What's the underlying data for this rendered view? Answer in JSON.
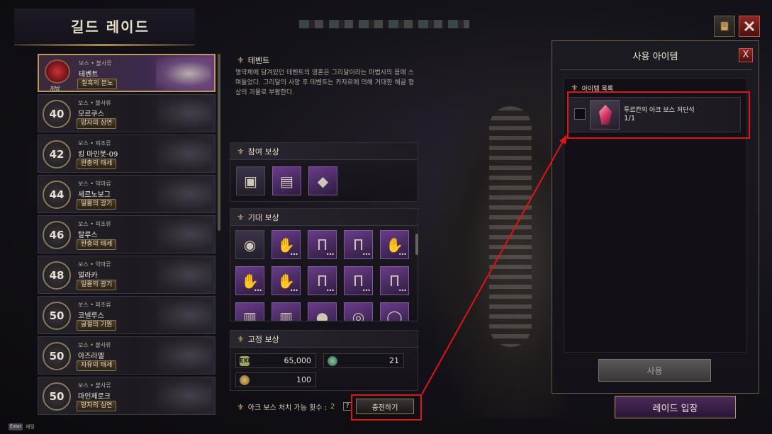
{
  "header": {
    "title": "길드 레이드"
  },
  "boss_list": [
    {
      "level": "",
      "open_label": "개방",
      "type": "보스 • 불사류",
      "name": "테벤트",
      "tag": "칠흑의 분노",
      "selected": true
    },
    {
      "level": "40",
      "type": "보스 • 불사류",
      "name": "모르쿠스",
      "tag": "망자의 심연"
    },
    {
      "level": "42",
      "type": "보스 • 피조류",
      "name": "킹 마인봇-09",
      "tag": "완충의 태세"
    },
    {
      "level": "44",
      "type": "보스 • 악마류",
      "name": "세르노보그",
      "tag": "일몰의 광기"
    },
    {
      "level": "46",
      "type": "보스 • 피조류",
      "name": "탈루스",
      "tag": "완충의 태세"
    },
    {
      "level": "48",
      "type": "보스 • 악마류",
      "name": "멀라카",
      "tag": "일몰의 광기"
    },
    {
      "level": "50",
      "type": "보스 • 피조류",
      "name": "코넬루스",
      "tag": "굴절의 기원"
    },
    {
      "level": "50",
      "type": "보스 • 불사류",
      "name": "아즈라엘",
      "tag": "자유의 태세"
    },
    {
      "level": "50",
      "type": "보스 • 불사류",
      "name": "마인제로크",
      "tag": "망자의 심연"
    }
  ],
  "event": {
    "heading": "테벤트",
    "description": "명약체에 담겨있던 테벤트의 영혼은 그리달이라는 마법사의 몸에 스며들었다. 그리달의 사망 후 테벤트는 카자르에 의해 거대한 해골 형상의 괴물로 부활한다."
  },
  "participation_reward": {
    "heading": "참여 보상",
    "items": [
      {
        "icon": "chest-icon",
        "glyph": "▣"
      },
      {
        "icon": "blue-chest-icon",
        "glyph": "▤"
      },
      {
        "icon": "gem-pouch-icon",
        "glyph": "◆"
      }
    ]
  },
  "expected_reward": {
    "heading": "기대 보상",
    "items": [
      {
        "icon": "pet-icon",
        "glyph": "◉"
      },
      {
        "icon": "gauntlet-icon",
        "glyph": "✋"
      },
      {
        "icon": "pants-icon",
        "glyph": "Π"
      },
      {
        "icon": "pants-icon",
        "glyph": "Π"
      },
      {
        "icon": "glove-icon",
        "glyph": "✋"
      },
      {
        "icon": "glove-icon",
        "glyph": "✋"
      },
      {
        "icon": "glove-icon",
        "glyph": "✋"
      },
      {
        "icon": "pants-icon",
        "glyph": "Π"
      },
      {
        "icon": "pants-icon",
        "glyph": "Π"
      },
      {
        "icon": "robe-icon",
        "glyph": "Π"
      },
      {
        "icon": "armor-icon",
        "glyph": "▥"
      },
      {
        "icon": "armor-icon",
        "glyph": "▥"
      },
      {
        "icon": "orb-icon",
        "glyph": "●"
      },
      {
        "icon": "ring-icon",
        "glyph": "◎"
      },
      {
        "icon": "ring-icon",
        "glyph": "◯"
      }
    ]
  },
  "fixed_reward": {
    "heading": "고정 보상",
    "exp_icon_label": "EXP",
    "exp_value": "65,000",
    "orb_value": "21",
    "gold_value": "100"
  },
  "ark_count": {
    "label": "아크 보스 처치 가능 횟수 :",
    "value": "2",
    "help": "?",
    "charge_button": "충전하기"
  },
  "use_dialog": {
    "title": "사용 아이템",
    "close": "X",
    "list_heading": "아이템 목록",
    "item_name": "투르칸의 아크 보스 처단석",
    "item_count": "1/1",
    "use_button": "사용"
  },
  "raid_enter_button": "레이드 입장",
  "footer": {
    "enter_key": "Enter",
    "chat_label": "채팅"
  },
  "colors": {
    "accent_gold": "#c9a86a",
    "highlight_red": "#e01414",
    "close_red": "#8a2a26"
  }
}
